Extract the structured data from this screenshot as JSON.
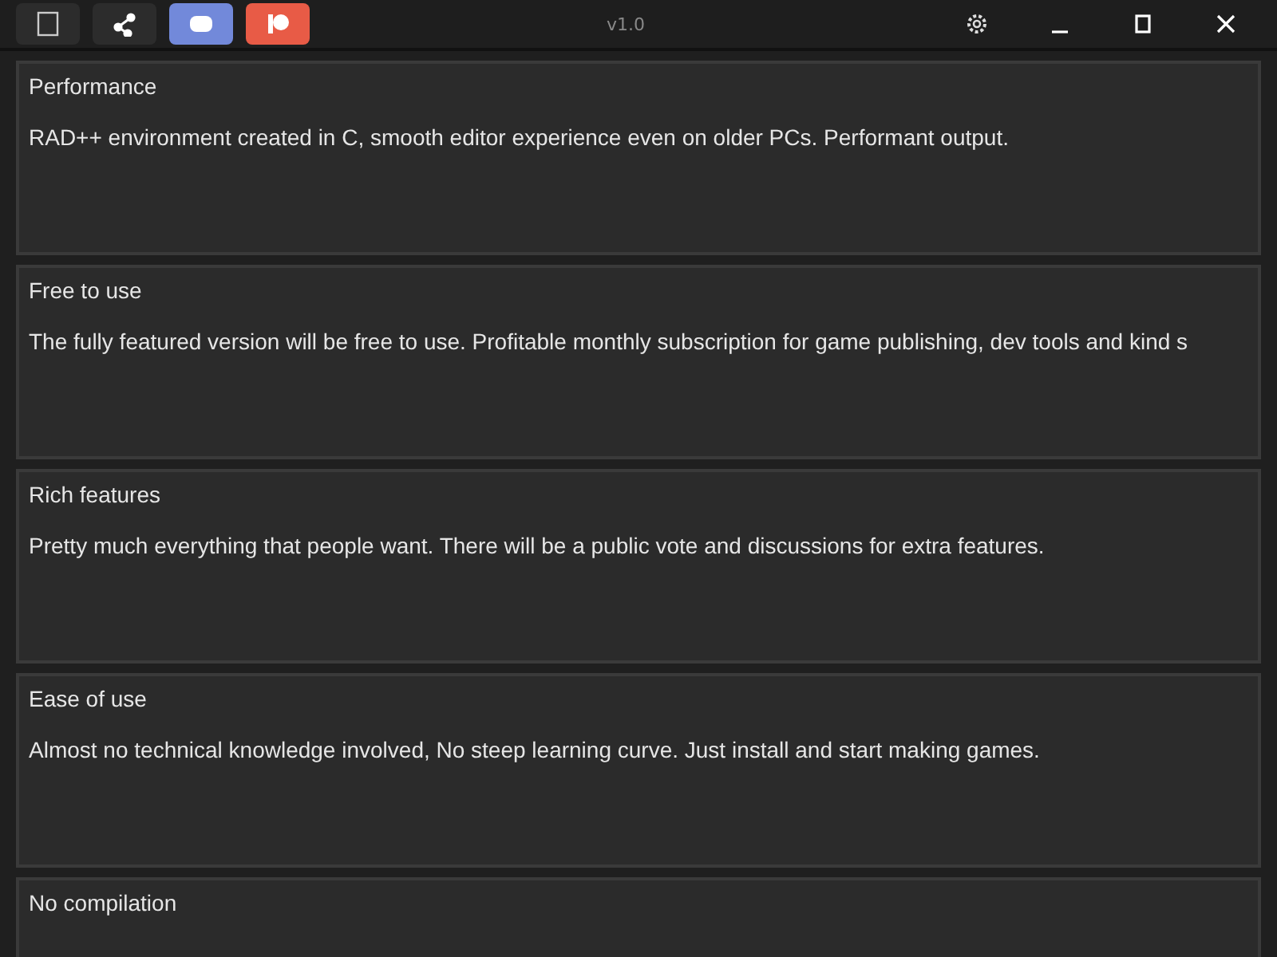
{
  "titlebar": {
    "version": "v1.0"
  },
  "features": [
    {
      "title": "Performance",
      "description": "RAD++ environment created in C, smooth editor experience even on older PCs. Performant output."
    },
    {
      "title": "Free to use",
      "description": "The fully featured version will be free to use. Profitable monthly subscription for game publishing, dev tools and kind s"
    },
    {
      "title": "Rich features",
      "description": "Pretty much everything that people want. There will be a public vote and discussions for extra features."
    },
    {
      "title": "Ease of use",
      "description": "Almost no technical knowledge involved, No steep learning curve. Just install and start making games."
    },
    {
      "title": "No compilation"
    }
  ]
}
